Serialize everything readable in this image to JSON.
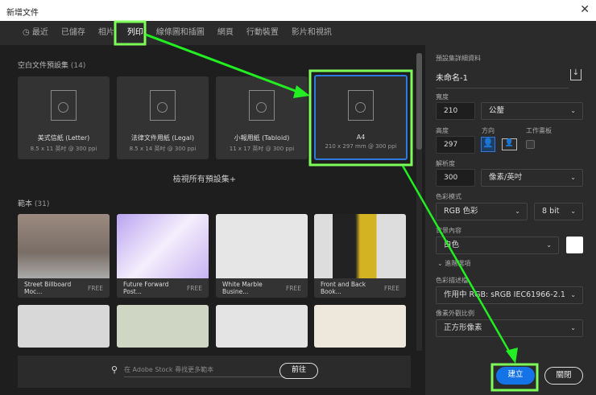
{
  "window": {
    "title": "新增文件",
    "close": "✕"
  },
  "tabs": [
    {
      "label": "最近"
    },
    {
      "label": "已儲存"
    },
    {
      "label": "相片"
    },
    {
      "label": "列印"
    },
    {
      "label": "線條圖和插圖"
    },
    {
      "label": "網頁"
    },
    {
      "label": "行動裝置"
    },
    {
      "label": "影片和視訊"
    }
  ],
  "presets": {
    "heading": "空白文件預設集",
    "count": "(14)",
    "view_all": "檢視所有預設集+",
    "items": [
      {
        "name": "美式信紙 (Letter)",
        "sub": "8.5 x 11 英吋 @ 300 ppi"
      },
      {
        "name": "法律文件用紙 (Legal)",
        "sub": "8.5 x 14 英吋 @ 300 ppi"
      },
      {
        "name": "小報用紙 (Tabloid)",
        "sub": "11 x 17 英吋 @ 300 ppi"
      },
      {
        "name": "A4",
        "sub": "210 x 297 mm @ 300 ppi"
      }
    ]
  },
  "templates": {
    "heading": "範本",
    "count": "(31)",
    "items": [
      {
        "name": "Street Billboard Moc...",
        "badge": "FREE"
      },
      {
        "name": "Future Forward Post...",
        "badge": "FREE"
      },
      {
        "name": "White Marble Busine...",
        "badge": "FREE"
      },
      {
        "name": "Front and Back Book...",
        "badge": "FREE"
      }
    ]
  },
  "stock": {
    "placeholder": "在 Adobe Stock 尋找更多範本",
    "go": "前往"
  },
  "details": {
    "heading": "預設集詳細資料",
    "name": "未命名-1",
    "width_label": "寬度",
    "width": "210",
    "unit": "公釐",
    "height_label": "高度",
    "height": "297",
    "orientation_label": "方向",
    "artboard_label": "工作畫板",
    "resolution_label": "解析度",
    "resolution": "300",
    "res_unit": "像素/英吋",
    "color_mode_label": "色彩模式",
    "color_mode": "RGB 色彩",
    "bit": "8 bit",
    "bg_label": "背景內容",
    "bg": "白色",
    "advanced": "進階選項",
    "profile_label": "色彩描述檔",
    "profile": "作用中 RGB: sRGB IEC61966-2.1",
    "aspect_label": "像素外觀比例",
    "aspect": "正方形像素",
    "create": "建立",
    "close": "關閉"
  },
  "colors": {
    "accent": "#2d7be0",
    "annotation": "#39ff14"
  }
}
